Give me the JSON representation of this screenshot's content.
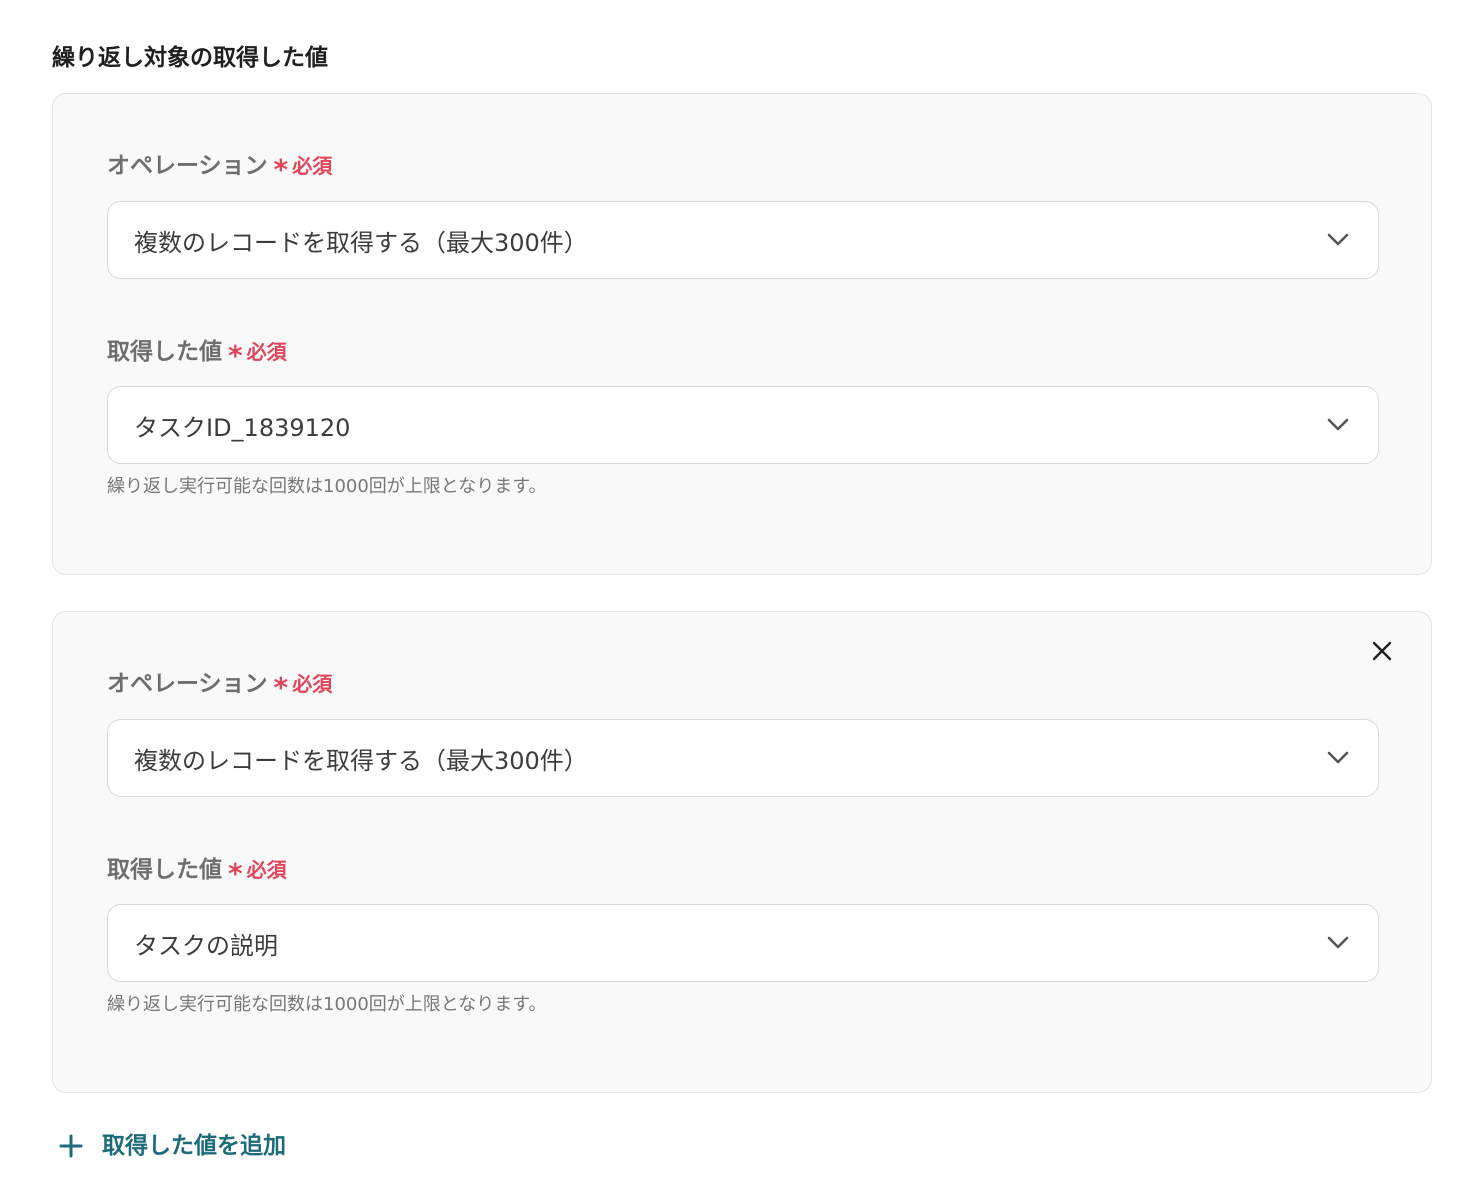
{
  "section": {
    "title": "繰り返し対象の取得した値"
  },
  "required_text": "必須",
  "required_mark": "*",
  "cards": [
    {
      "operation_label": "オペレーション",
      "operation_value": "複数のレコードを取得する（最大300件）",
      "value_label": "取得した値",
      "value_value": "タスクID_1839120",
      "helper": "繰り返し実行可能な回数は1000回が上限となります。"
    },
    {
      "operation_label": "オペレーション",
      "operation_value": "複数のレコードを取得する（最大300件）",
      "value_label": "取得した値",
      "value_value": "タスクの説明",
      "helper": "繰り返し実行可能な回数は1000回が上限となります。"
    }
  ],
  "add_button": {
    "label": "取得した値を追加",
    "icon": "plus-icon"
  },
  "icons": {
    "dropdown": "chevron-down-icon",
    "remove": "close-icon"
  },
  "colors": {
    "required": "#e0455a",
    "accent": "#1c6b7a",
    "card_bg": "#f9f9f9"
  }
}
